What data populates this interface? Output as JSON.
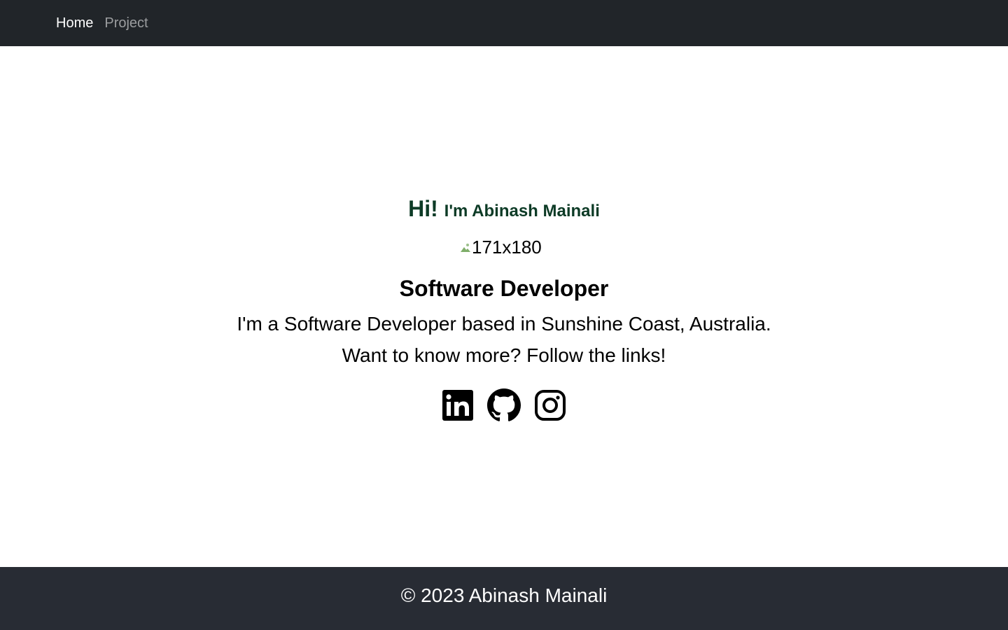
{
  "navbar": {
    "items": [
      {
        "label": "Home",
        "active": true
      },
      {
        "label": "Project",
        "active": false
      }
    ]
  },
  "hero": {
    "greeting_hi": "Hi!",
    "greeting_name": "I'm Abinash Mainali",
    "avatar_alt": "171x180",
    "role": "Software Developer",
    "bio": "I'm a Software Developer based in Sunshine Coast, Australia.",
    "cta": "Want to know more? Follow the links!",
    "socials": [
      {
        "icon": "linkedin-icon"
      },
      {
        "icon": "github-icon"
      },
      {
        "icon": "instagram-icon"
      }
    ]
  },
  "footer": {
    "text": "© 2023 Abinash Mainali"
  },
  "colors": {
    "navbar_bg": "#212529",
    "footer_bg": "#282c34",
    "greeting": "#0d3b26"
  }
}
